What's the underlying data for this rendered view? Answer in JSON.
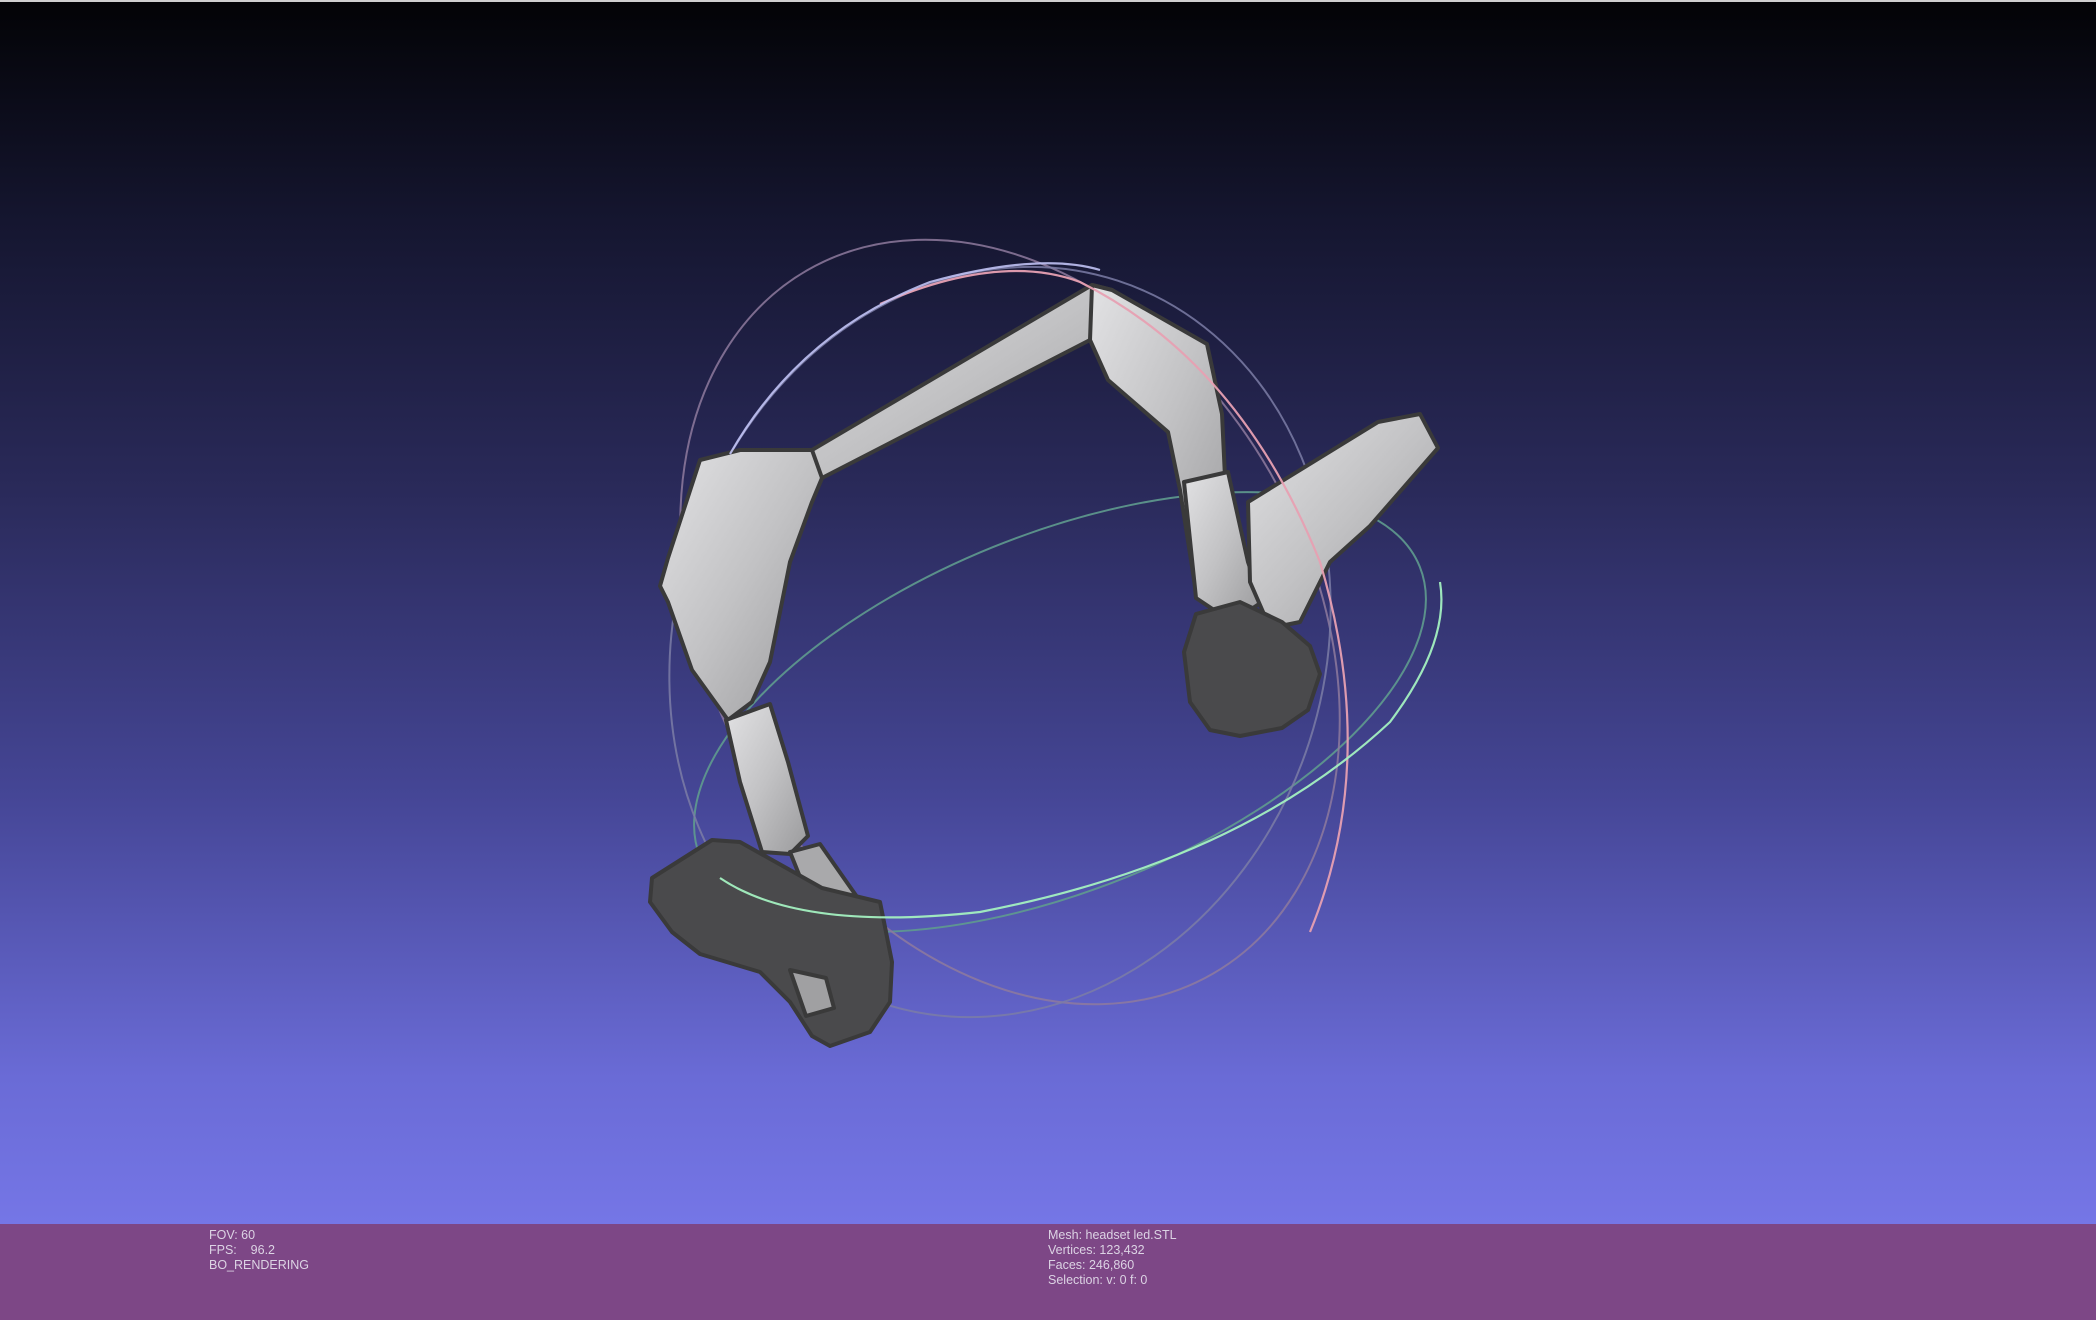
{
  "viewer": {
    "colors": {
      "background_top": "#030306",
      "background_bottom": "#7576e6",
      "statusbar": "#7d4786",
      "mesh_fill": "#c9c9cb",
      "mesh_edge": "#3a3a3a",
      "trackball_x": "#e08a9c",
      "trackball_y": "#8ee6b0",
      "trackball_z": "#b0b0e6"
    }
  },
  "status_left": {
    "fov": "FOV: 60",
    "fps": "FPS:    96.2",
    "mode": "BO_RENDERING"
  },
  "status_right": {
    "mesh": "Mesh: headset led.STL",
    "vertices": "Vertices: 123,432",
    "faces": "Faces: 246,860",
    "selection": "Selection: v: 0 f: 0"
  }
}
